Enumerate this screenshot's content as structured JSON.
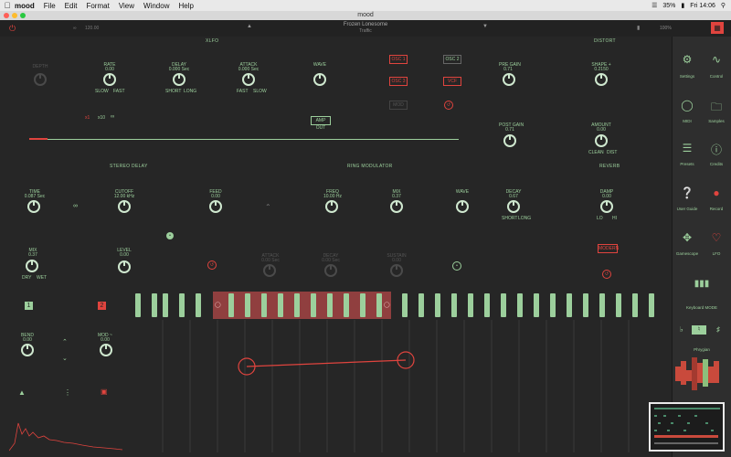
{
  "menubar": {
    "app": "mood",
    "items": [
      "File",
      "Edit",
      "Format",
      "View",
      "Window",
      "Help"
    ],
    "battery": "35%",
    "clock": "Fri 14:06"
  },
  "window": {
    "title": "mood"
  },
  "topbar": {
    "preset_value": "120.00",
    "song": "Frozen Lonesome",
    "subtitle": "Traffic",
    "zoom": "100%"
  },
  "sections": {
    "xlfo": "XLFO",
    "distort": "DISTORT",
    "stereo_delay": "STEREO DELAY",
    "ring_mod": "RING MODULATOR",
    "reverb": "REVERB"
  },
  "xlfo": {
    "knobs": [
      {
        "label": "DEPTH",
        "value": "",
        "min": "",
        "max": ""
      },
      {
        "label": "RATE",
        "value": "0.00",
        "min": "SLOW",
        "max": "FAST"
      },
      {
        "label": "DELAY",
        "value": "0.000 Sec",
        "min": "SHORT",
        "max": "LONG"
      },
      {
        "label": "ATTACK",
        "value": "0.000 Sec",
        "min": "FAST",
        "max": "SLOW"
      },
      {
        "label": "WAVE",
        "value": "",
        "min": "",
        "max": ""
      }
    ],
    "amp_out": "AMP OUT",
    "ratio_a": "x1",
    "ratio_b": "x10"
  },
  "osc": {
    "osc1": "OSC 1",
    "osc2": "OSC 2",
    "osc3": "OSC 3",
    "vcf": "VCF",
    "mod": "MOD"
  },
  "distort": {
    "knobs": [
      {
        "label": "PRE GAIN",
        "value": "0.71"
      },
      {
        "label": "SHAPE +",
        "value": "0.2150"
      },
      {
        "label": "POST GAIN",
        "value": "0.71"
      },
      {
        "label": "AMOUNT",
        "value": "0.00",
        "min": "CLEAN",
        "max": "DIST"
      }
    ]
  },
  "stereo_delay": {
    "knobs": [
      {
        "label": "TIME",
        "value": "0.087 Sec"
      },
      {
        "label": "CUTOFF",
        "value": "12.00 kHz"
      },
      {
        "label": "FEED",
        "value": "0.00"
      },
      {
        "label": "MIX",
        "value": "0.37",
        "min": "DRY",
        "max": "WET"
      },
      {
        "label": "LEVEL",
        "value": "0.00"
      }
    ]
  },
  "ring_mod": {
    "knobs": [
      {
        "label": "FREQ",
        "value": "10.00 Hz"
      },
      {
        "label": "MIX",
        "value": "0.37"
      },
      {
        "label": "WAVE",
        "value": ""
      },
      {
        "label": "ATTACK",
        "value": "0.00 Sec"
      },
      {
        "label": "DECAY",
        "value": "0.00 Sec"
      },
      {
        "label": "SUSTAIN",
        "value": "0.00"
      }
    ]
  },
  "reverb": {
    "knobs": [
      {
        "label": "DECAY",
        "value": "0.67",
        "min": "SHORT",
        "max": "LONG"
      },
      {
        "label": "DAMP",
        "value": "0.00",
        "min": "LO",
        "max": "HI"
      }
    ],
    "modern": "MODERN"
  },
  "bottom": {
    "btn1": "1",
    "btn2": "2",
    "bend": "BEND",
    "bend_value": "0.00",
    "mod": "MOD ~",
    "mod_value": "0.00"
  },
  "sidebar": {
    "items": [
      {
        "label": "Settings",
        "icon": "gear-icon"
      },
      {
        "label": "Control",
        "icon": "control-icon"
      },
      {
        "label": "MIDI",
        "icon": "midi-icon"
      },
      {
        "label": "Samples",
        "icon": "folder-icon"
      },
      {
        "label": "Presets",
        "icon": "list-icon"
      },
      {
        "label": "Credits",
        "icon": "info-icon"
      },
      {
        "label": "User Guide",
        "icon": "help-icon"
      },
      {
        "label": "Record",
        "icon": "record-icon"
      },
      {
        "label": "Gamescope",
        "icon": "crosshair-icon"
      },
      {
        "label": "LFO",
        "icon": "heart-icon"
      }
    ],
    "keyboard_mode": "Keyboard MODE",
    "phrygian": "Phrygian"
  },
  "colors": {
    "accent": "#9ccf9c",
    "alert": "#e0443e",
    "bg": "#262626"
  }
}
